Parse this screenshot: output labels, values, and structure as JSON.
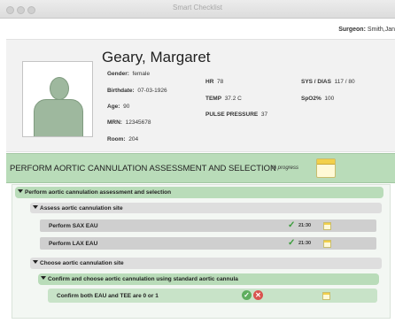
{
  "window": {
    "title": "Smart Checklist"
  },
  "surgeon": {
    "label": "Surgeon:",
    "value": "Smith,Jan"
  },
  "patient": {
    "name": "Geary, Margaret",
    "gender_label": "Gender:",
    "gender": "female",
    "birthdate_label": "Birthdate:",
    "birthdate": "07-03-1926",
    "age_label": "Age:",
    "age": "90",
    "mrn_label": "MRN:",
    "mrn": "12345678",
    "room_label": "Room:",
    "room": "204"
  },
  "vitals": {
    "hr_label": "HR",
    "hr": "78",
    "temp_label": "TEMP",
    "temp": "37.2  C",
    "pp_label": "PULSE PRESSURE",
    "pp": "37",
    "bp_label": "SYS / DIAS",
    "bp": "117  /  80",
    "spo2_label": "SpO2%",
    "spo2": "100"
  },
  "section": {
    "title": "PERFORM AORTIC CANNULATION ASSESSMENT AND SELECTION",
    "status": "In progress"
  },
  "tasks": {
    "group_title": "Perform aortic cannulation assessment and selection",
    "assess_title": "Assess aortic cannulation site",
    "items": [
      {
        "label": "Perform SAX EAU",
        "time": "21:30"
      },
      {
        "label": "Perform LAX EAU",
        "time": "21:30"
      }
    ],
    "choose_title": "Choose aortic cannulation site",
    "confirm_title": "Confirm and choose aortic cannulation using standard aortic cannula",
    "confirm_item": "Confirm both EAU and TEE are 0 or 1"
  },
  "icons": {
    "check": "check-icon",
    "calendar": "calendar-icon",
    "confirm": "check-circle-icon",
    "reject": "x-circle-icon"
  },
  "colors": {
    "section_green": "#b9dcb9",
    "check_green": "#3a9c3a",
    "reject_red": "#d9534f",
    "calendar_yellow": "#f2d04a"
  }
}
